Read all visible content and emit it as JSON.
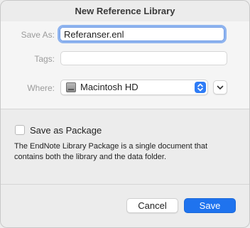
{
  "dialog": {
    "title": "New Reference Library"
  },
  "form": {
    "save_as_label": "Save As:",
    "save_as_value": "Referanser.enl",
    "tags_label": "Tags:",
    "tags_value": "",
    "where_label": "Where:",
    "where_value": "Macintosh HD",
    "where_icon": "disk-icon"
  },
  "options": {
    "package_label": "Save as Package",
    "package_checked": false,
    "description": "The EndNote Library Package is a single document that contains both the library and the data folder."
  },
  "buttons": {
    "cancel_label": "Cancel",
    "save_label": "Save"
  },
  "colors": {
    "accent": "#1f73ee",
    "focus_ring": "#8fb4ef"
  }
}
